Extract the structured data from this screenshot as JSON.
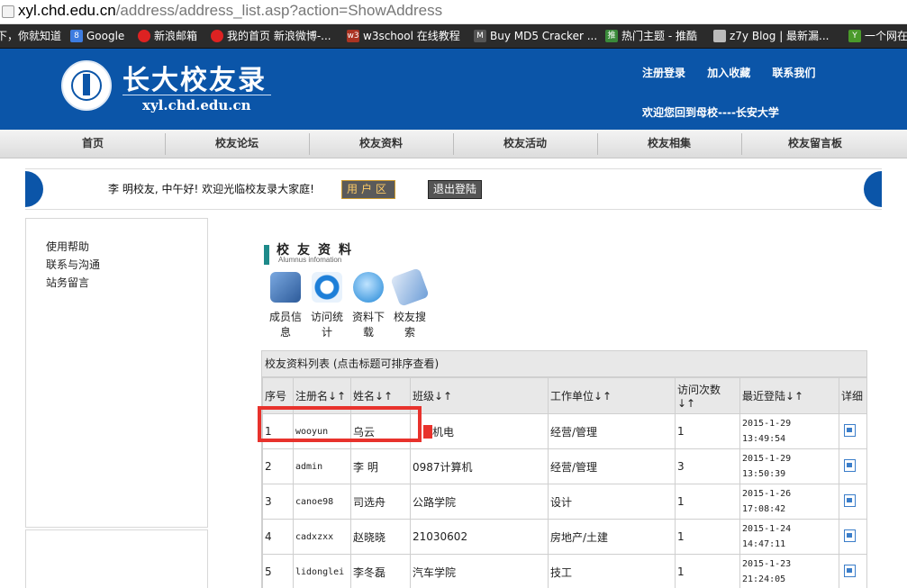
{
  "browser": {
    "url_host": "xyl.chd.edu.cn",
    "url_path": "/address/address_list.asp?action=ShowAddress",
    "bookmarks": [
      {
        "label": "下，你就知道",
        "icon": "paw-icon",
        "color": "#2b2b2b"
      },
      {
        "label": "Google",
        "icon": "google-icon",
        "color": "#3d7ce0"
      },
      {
        "label": "新浪邮箱",
        "icon": "sina-icon",
        "color": "#d22"
      },
      {
        "label": "我的首页 新浪微博-...",
        "icon": "weibo-icon",
        "color": "#d22"
      },
      {
        "label": "w3school 在线教程",
        "icon": "w3-icon",
        "color": "#a32"
      },
      {
        "label": "Buy MD5 Cracker ...",
        "icon": "md5-icon",
        "color": "#555"
      },
      {
        "label": "热门主题 - 推酷",
        "icon": "tuicool-icon",
        "color": "#3a8a3a"
      },
      {
        "label": "z7y Blog | 最新漏...",
        "icon": "z7y-icon",
        "color": "#bbb"
      },
      {
        "label": "一个网在",
        "icon": "y-icon",
        "color": "#4a9a2a"
      }
    ]
  },
  "header": {
    "title": "长大校友录",
    "domain": "xyl.chd.edu.cn",
    "links": [
      "注册登录",
      "加入收藏",
      "联系我们"
    ],
    "welcome": "欢迎您回到母校----长安大学"
  },
  "nav": [
    "首页",
    "校友论坛",
    "校友资料",
    "校友活动",
    "校友相集",
    "校友留言板"
  ],
  "userbar": {
    "greeting": "李 明校友, 中午好! 欢迎光临校友录大家庭!",
    "user_area": "用户区",
    "logout": "退出登陆"
  },
  "sidebar": [
    "使用帮助",
    "联系与沟通",
    "站务留言"
  ],
  "section": {
    "title": "校友资料",
    "subtitle": "Alumnus infomation"
  },
  "tools": [
    {
      "label": "成员信息",
      "icon": "member-info-icon"
    },
    {
      "label": "访问统计",
      "icon": "visit-stats-icon"
    },
    {
      "label": "资料下载",
      "icon": "download-icon"
    },
    {
      "label": "校友搜索",
      "icon": "search-icon"
    }
  ],
  "table": {
    "caption": "校友资料列表 (点击标题可排序查看)",
    "headers": [
      "序号",
      "注册名↓↑",
      "姓名↓↑",
      "班级↓↑",
      "工作单位↓↑",
      "访问次数↓↑",
      "最近登陆↓↑",
      "详细"
    ],
    "rows": [
      {
        "no": "1",
        "username": "wooyun",
        "name": "乌云",
        "class": "机电",
        "work": "经营/管理",
        "visits": "1",
        "date": "2015-1-29",
        "time": "13:49:54"
      },
      {
        "no": "2",
        "username": "admin",
        "name": "李 明",
        "class": "0987计算机",
        "work": "经营/管理",
        "visits": "3",
        "date": "2015-1-29",
        "time": "13:50:39"
      },
      {
        "no": "3",
        "username": "canoe98",
        "name": "司选舟",
        "class": "公路学院",
        "work": "设计",
        "visits": "1",
        "date": "2015-1-26",
        "time": "17:08:42"
      },
      {
        "no": "4",
        "username": "cadxzxx",
        "name": "赵晓晓",
        "class": "21030602",
        "work": "房地产/土建",
        "visits": "1",
        "date": "2015-1-24",
        "time": "14:47:11"
      },
      {
        "no": "5",
        "username": "lidonglei",
        "name": "李冬磊",
        "class": "汽车学院",
        "work": "技工",
        "visits": "1",
        "date": "2015-1-23",
        "time": "21:24:05"
      }
    ]
  },
  "colors": {
    "header_bg": "#0b55a8",
    "highlight": "#e8322c",
    "section_bar": "#1e8a8a"
  }
}
